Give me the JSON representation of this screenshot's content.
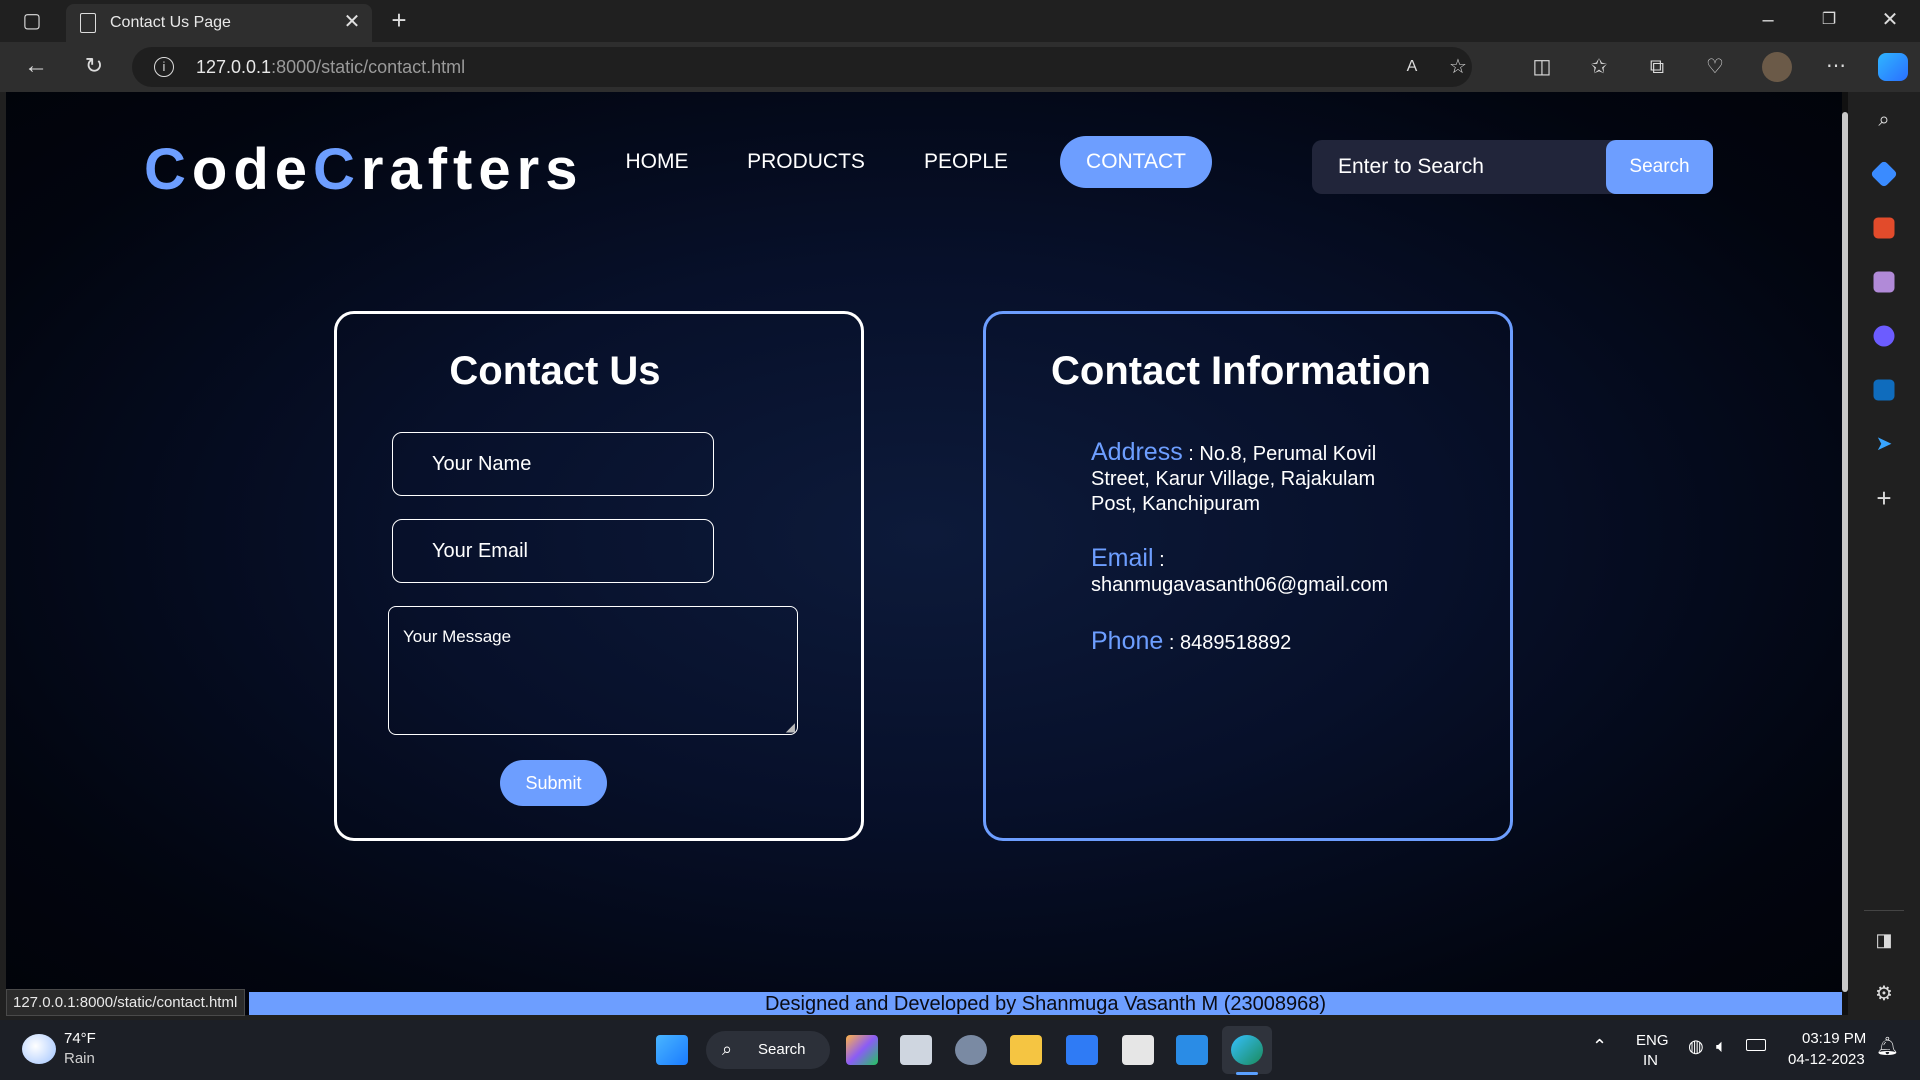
{
  "browser": {
    "tab_title": "Contact Us Page",
    "url_host": "127.0.0.1",
    "url_rest": ":8000/static/contact.html",
    "status_url": "127.0.0.1:8000/static/contact.html"
  },
  "header": {
    "logo_c1": "C",
    "logo_rest1": "ode",
    "logo_c2": "C",
    "logo_rest2": "rafters",
    "nav": [
      "HOME",
      "PRODUCTS",
      "PEOPLE",
      "CONTACT"
    ],
    "active_nav": "CONTACT",
    "search_placeholder": "Enter to Search",
    "search_button": "Search"
  },
  "contact_form": {
    "title": "Contact Us",
    "name_placeholder": "Your Name",
    "email_placeholder": "Your Email",
    "message_placeholder": "Your Message",
    "submit_label": "Submit"
  },
  "contact_info": {
    "title": "Contact Information",
    "address_label": "Address",
    "address_value": "No.8, Perumal Kovil Street, Karur Village, Rajakulam Post, Kanchipuram",
    "email_label": "Email",
    "email_value": "shanmugavasanth06@gmail.com",
    "phone_label": "Phone",
    "phone_value": "8489518892",
    "separator": ":"
  },
  "footer": {
    "text": "Designed and Developed by Shanmuga Vasanth M (23008968)"
  },
  "taskbar": {
    "weather_temp": "74°F",
    "weather_desc": "Rain",
    "search_label": "Search",
    "lang_1": "ENG",
    "lang_2": "IN",
    "time": "03:19 PM",
    "date": "04-12-2023"
  },
  "colors": {
    "accent": "#6d9eff",
    "page_bg": "#02050f",
    "text": "#ffffff"
  }
}
